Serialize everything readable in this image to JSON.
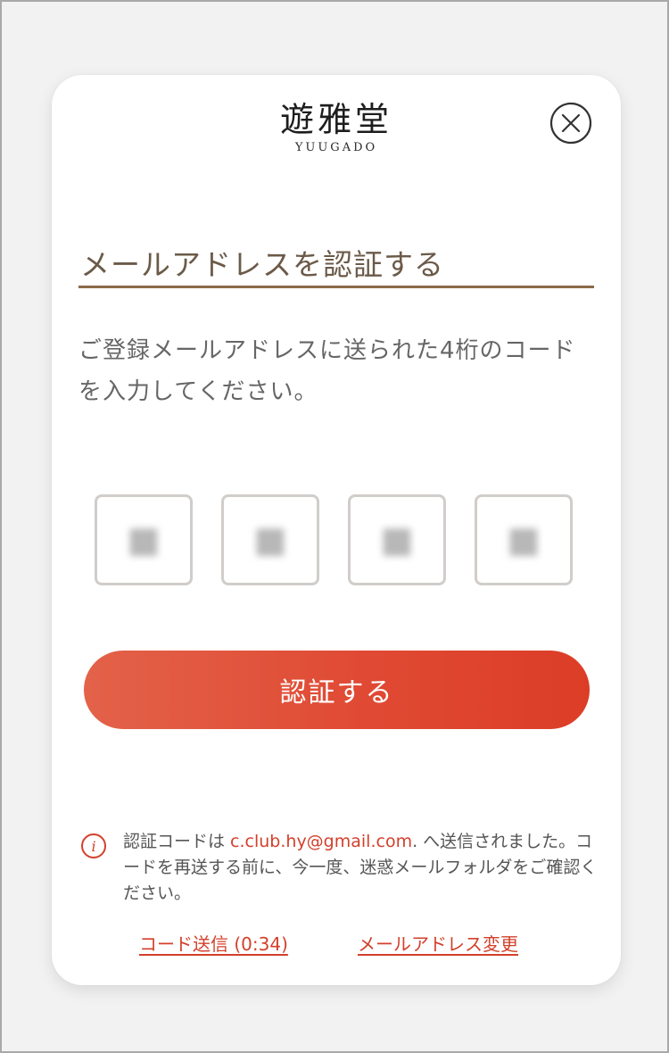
{
  "brand": {
    "logo_kanji": "遊雅堂",
    "logo_roman": "YUUGADO",
    "accent_color": "#d8301f"
  },
  "header": {
    "close_icon": "close-circle-icon"
  },
  "main": {
    "title": "メールアドレスを認証する",
    "instructions": "ご登録メールアドレスに送られた4桁のコードを入力してください。",
    "code_digits": [
      "■",
      "■",
      "■",
      "■"
    ],
    "verify_button": "認証する"
  },
  "info": {
    "icon": "info-icon",
    "text_before": "認証コードは ",
    "email": "c.club.hy@gmail.com",
    "text_after": ". へ送信されました。コードを再送する前に、今一度、迷惑メールフォルダをご確認ください。"
  },
  "links": {
    "resend": "コード送信 (0:34)",
    "change_email": "メールアドレス変更"
  },
  "colors": {
    "button": "#e04a34",
    "title": "#6b5a49",
    "title_rule": "#8a6a4a",
    "link": "#d3402b"
  }
}
